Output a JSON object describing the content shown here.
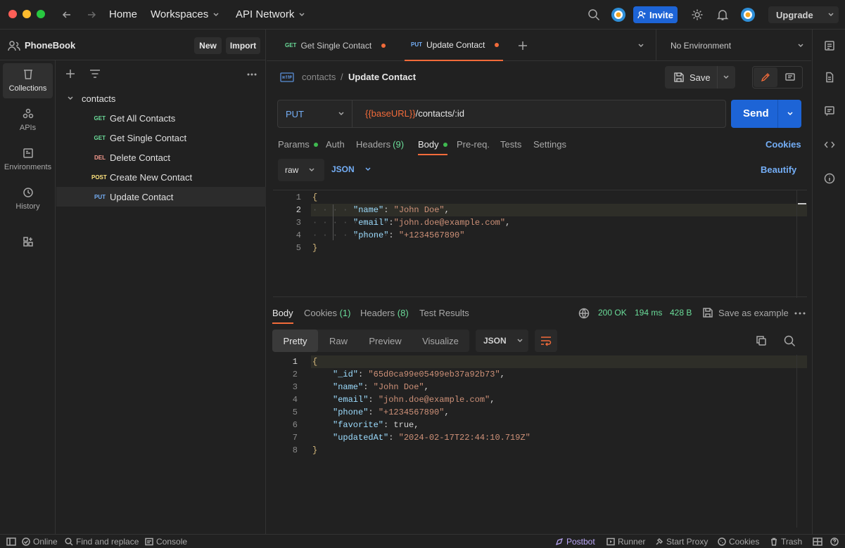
{
  "topbar": {
    "home": "Home",
    "workspaces": "Workspaces",
    "api_network": "API Network",
    "invite": "Invite",
    "upgrade": "Upgrade"
  },
  "rail": {
    "collections": "Collections",
    "apis": "APIs",
    "environments": "Environments",
    "history": "History"
  },
  "workspace": {
    "name": "PhoneBook",
    "new_label": "New",
    "import_label": "Import"
  },
  "tree": {
    "folder": "contacts",
    "items": [
      {
        "method": "GET",
        "name": "Get All Contacts"
      },
      {
        "method": "GET",
        "name": "Get Single Contact"
      },
      {
        "method": "DEL",
        "name": "Delete Contact"
      },
      {
        "method": "POST",
        "name": "Create New Contact"
      },
      {
        "method": "PUT",
        "name": "Update Contact"
      }
    ]
  },
  "tabs": [
    {
      "method": "GET",
      "name": "Get Single Contact"
    },
    {
      "method": "PUT",
      "name": "Update Contact"
    }
  ],
  "environment": "No Environment",
  "request": {
    "breadcrumb_root": "contacts",
    "breadcrumb_sep": "/",
    "title": "Update Contact",
    "save_label": "Save",
    "method": "PUT",
    "url_var": "{{baseURL}}",
    "url_path": "/contacts/:id",
    "send_label": "Send",
    "tabs": {
      "params": "Params",
      "auth": "Auth",
      "headers": "Headers",
      "headers_count": "(9)",
      "body": "Body",
      "prereq": "Pre-req.",
      "tests": "Tests",
      "settings": "Settings"
    },
    "cookies_label": "Cookies",
    "body_mode": "raw",
    "body_format": "JSON",
    "beautify_label": "Beautify",
    "body_lines": {
      "l1": "{",
      "l2k": "\"name\"",
      "l2v": "\"John Doe\"",
      "l3k": "\"email\"",
      "l3v": "\"john.doe@example.com\"",
      "l4k": "\"phone\"",
      "l4v": "\"+1234567890\"",
      "l5": "}"
    }
  },
  "response": {
    "tabs": {
      "body": "Body",
      "cookies": "Cookies",
      "cookies_count": "(1)",
      "headers": "Headers",
      "headers_count": "(8)",
      "tests": "Test Results"
    },
    "status": "200 OK",
    "time": "194 ms",
    "size": "428 B",
    "save_example": "Save as example",
    "views": {
      "pretty": "Pretty",
      "raw": "Raw",
      "preview": "Preview",
      "visualize": "Visualize"
    },
    "format": "JSON",
    "lines": {
      "l1": "{",
      "id_k": "\"_id\"",
      "id_v": "\"65d0ca99e05499eb37a92b73\"",
      "name_k": "\"name\"",
      "name_v": "\"John Doe\"",
      "email_k": "\"email\"",
      "email_v": "\"john.doe@example.com\"",
      "phone_k": "\"phone\"",
      "phone_v": "\"+1234567890\"",
      "fav_k": "\"favorite\"",
      "fav_v": "true",
      "upd_k": "\"updatedAt\"",
      "upd_v": "\"2024-02-17T22:44:10.719Z\"",
      "l8": "}"
    }
  },
  "statusbar": {
    "online": "Online",
    "find": "Find and replace",
    "console": "Console",
    "postbot": "Postbot",
    "runner": "Runner",
    "proxy": "Start Proxy",
    "cookies": "Cookies",
    "trash": "Trash"
  },
  "colors": {
    "accent_orange": "#f26b3a",
    "accent_blue": "#1d64d6",
    "get": "#6bdd9a",
    "put": "#74aef6",
    "del": "#f79a8e",
    "post": "#ffe47e"
  }
}
